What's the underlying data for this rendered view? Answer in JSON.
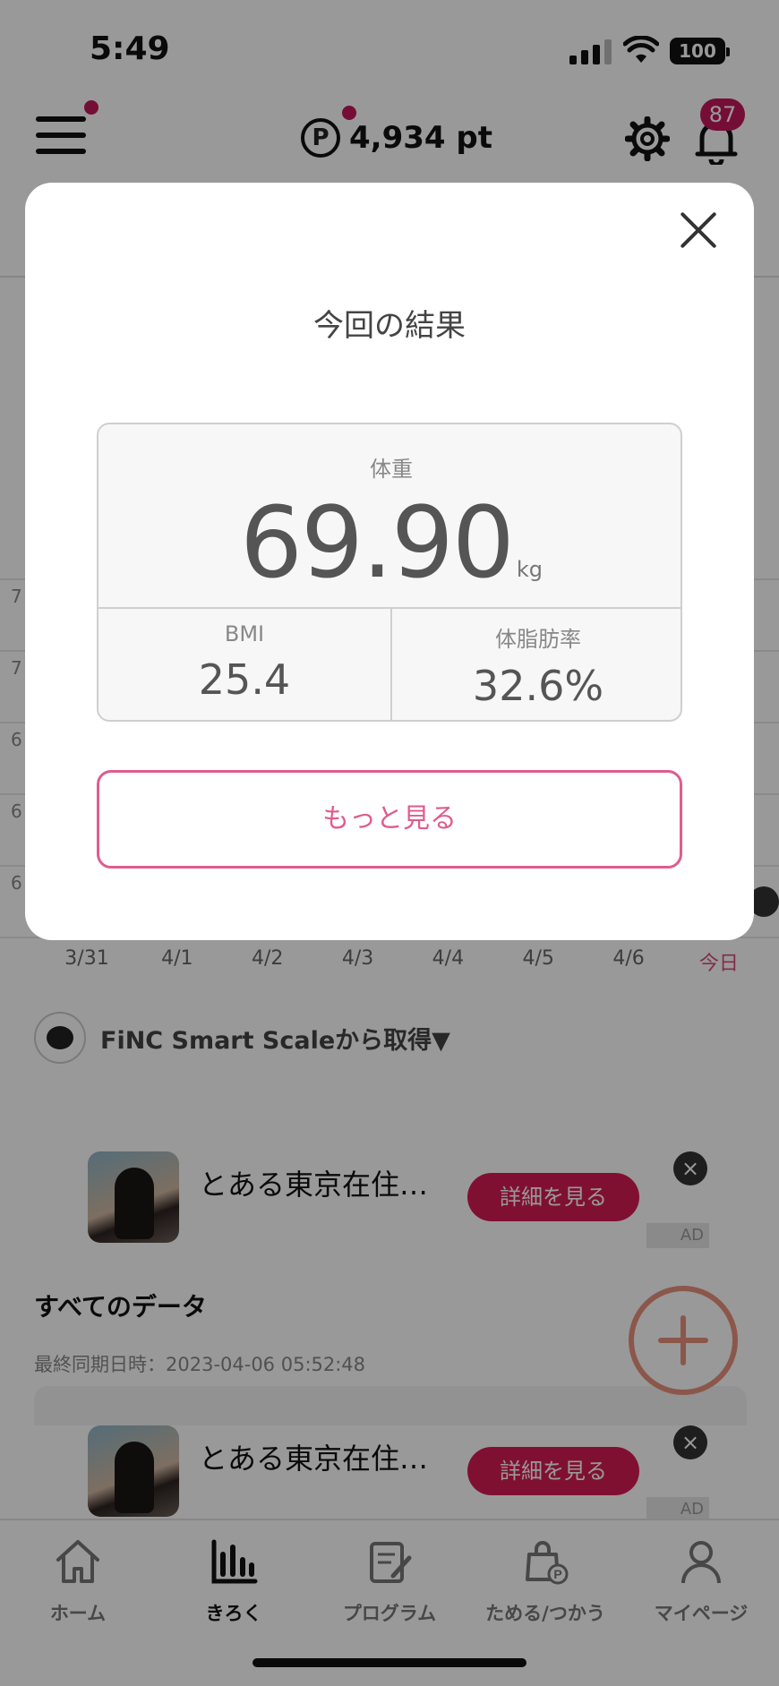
{
  "status_bar": {
    "time": "5:49",
    "battery": "100"
  },
  "header": {
    "points": "4,934 pt",
    "points_symbol": "P",
    "notification_count": "87"
  },
  "chart_bg": {
    "y_ticks": [
      "7",
      "7",
      "6",
      "6",
      "6"
    ],
    "x_labels": [
      "3/31",
      "4/1",
      "4/2",
      "4/3",
      "4/4",
      "4/5",
      "4/6",
      "今日"
    ]
  },
  "source": {
    "label": "FiNC Smart Scaleから取得▼"
  },
  "ads": [
    {
      "title": "とある東京在住…",
      "button": "詳細を見る",
      "mark": "AD",
      "close": "×"
    },
    {
      "title": "とある東京在住…",
      "button": "詳細を見る",
      "mark": "AD",
      "close": "×"
    }
  ],
  "all_data": {
    "title": "すべてのデータ",
    "last_sync": "最終同期日時：2023-04-06 05:52:48"
  },
  "bottom_nav": {
    "items": [
      {
        "label": "ホーム",
        "icon": "home-icon"
      },
      {
        "label": "きろく",
        "icon": "chart-icon"
      },
      {
        "label": "プログラム",
        "icon": "program-icon"
      },
      {
        "label": "ためる/つかう",
        "icon": "points-bag-icon"
      },
      {
        "label": "マイページ",
        "icon": "person-icon"
      }
    ]
  },
  "modal": {
    "title": "今回の結果",
    "weight_label": "体重",
    "weight_value": "69.90",
    "weight_unit": "kg",
    "bmi_label": "BMI",
    "bmi_value": "25.4",
    "bodyfat_label": "体脂肪率",
    "bodyfat_value": "32.6%",
    "more_button": "もっと見る"
  },
  "colors": {
    "accent": "#e05c8d",
    "badge": "#c2185b",
    "ad_button": "#d61b54",
    "fab": "#e8917e"
  }
}
